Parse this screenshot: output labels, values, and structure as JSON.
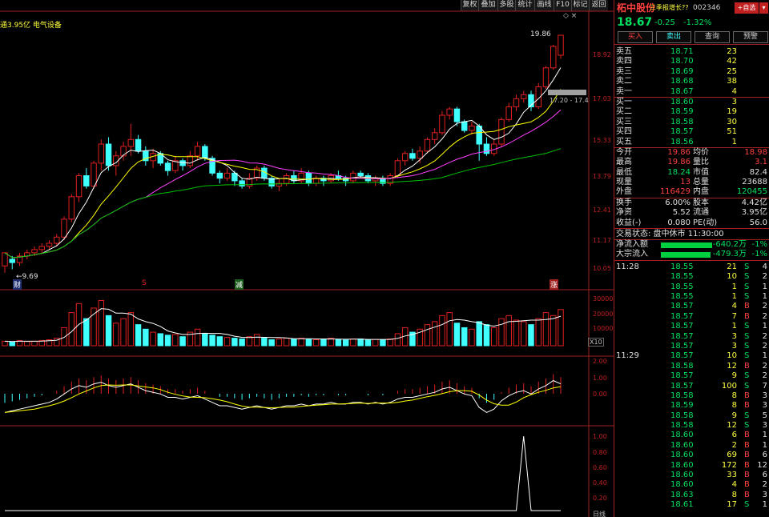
{
  "toolbar": {
    "buttons": [
      "复权",
      "叠加",
      "多股",
      "统计",
      "画线",
      "F10",
      "标记",
      "返回"
    ]
  },
  "chart": {
    "market_cap_label": "通3.95亿 电气设备",
    "price_axis": [
      "18.92",
      "17.03",
      "15.33",
      "13.79",
      "12.41",
      "11.17",
      "10.05"
    ],
    "high_label": "19.86",
    "low_label": "9.69",
    "price_range_label": "17.20 - 17.4",
    "markers": [
      "财",
      "S",
      "减",
      "涨"
    ],
    "volume_axis": [
      "30000",
      "20000",
      "10000"
    ],
    "volume_unit": "X10",
    "macd_axis": [
      "2.00",
      "1.00",
      "0.00"
    ],
    "ind3_axis": [
      "1.00",
      "0.80",
      "0.60",
      "0.40",
      "0.20"
    ],
    "bottom_label": "日线",
    "colors": {
      "up": "#e02020",
      "down": "#40ffff",
      "ma5": "#ffffff",
      "ma10": "#ffff00",
      "ma20": "#ff40ff",
      "ma60": "#00c000"
    }
  },
  "chart_data": {
    "type": "candlestick",
    "candles": [
      [
        9.9,
        10.3,
        9.7,
        10.1
      ],
      [
        10.1,
        10.0,
        9.8,
        10.2
      ],
      [
        10.0,
        10.2,
        9.9,
        10.3
      ],
      [
        10.2,
        10.3,
        10.1,
        10.4
      ],
      [
        10.3,
        10.4,
        10.2,
        10.5
      ],
      [
        10.4,
        10.5,
        10.3,
        10.6
      ],
      [
        10.5,
        10.6,
        10.4,
        10.7
      ],
      [
        10.6,
        10.8,
        10.5,
        10.9
      ],
      [
        10.8,
        11.4,
        10.7,
        11.5
      ],
      [
        11.4,
        12.2,
        11.3,
        12.3
      ],
      [
        12.2,
        13.0,
        12.0,
        13.1
      ],
      [
        13.0,
        12.6,
        12.5,
        13.3
      ],
      [
        12.6,
        13.5,
        12.5,
        13.6
      ],
      [
        13.5,
        14.3,
        13.2,
        14.5
      ],
      [
        14.3,
        13.4,
        13.2,
        14.6
      ],
      [
        13.4,
        13.8,
        13.0,
        14.0
      ],
      [
        13.8,
        14.2,
        13.6,
        14.4
      ],
      [
        14.2,
        14.5,
        13.8,
        15.2
      ],
      [
        14.5,
        14.0,
        13.9,
        14.7
      ],
      [
        14.0,
        13.6,
        13.4,
        14.2
      ],
      [
        13.6,
        13.9,
        13.3,
        14.1
      ],
      [
        13.9,
        13.5,
        13.4,
        14.0
      ],
      [
        13.5,
        13.2,
        13.0,
        13.6
      ],
      [
        13.2,
        13.6,
        13.1,
        13.8
      ],
      [
        13.6,
        13.4,
        13.2,
        13.7
      ],
      [
        13.4,
        13.8,
        13.3,
        14.0
      ],
      [
        13.8,
        14.2,
        13.6,
        14.4
      ],
      [
        14.2,
        13.7,
        13.6,
        14.3
      ],
      [
        13.7,
        13.1,
        13.0,
        13.8
      ],
      [
        13.1,
        12.9,
        12.7,
        13.2
      ],
      [
        12.9,
        13.1,
        12.8,
        13.3
      ],
      [
        13.1,
        12.8,
        12.6,
        13.2
      ],
      [
        12.8,
        12.6,
        12.5,
        12.9
      ],
      [
        12.6,
        12.9,
        12.5,
        13.1
      ],
      [
        12.9,
        13.3,
        12.8,
        13.4
      ],
      [
        13.3,
        12.9,
        12.8,
        13.4
      ],
      [
        12.9,
        12.6,
        12.5,
        13.0
      ],
      [
        12.6,
        12.7,
        12.4,
        12.9
      ],
      [
        12.7,
        13.0,
        12.6,
        13.1
      ],
      [
        13.0,
        12.8,
        12.7,
        13.2
      ],
      [
        12.8,
        13.1,
        12.7,
        13.3
      ],
      [
        13.1,
        12.7,
        12.6,
        13.2
      ],
      [
        12.7,
        12.9,
        12.6,
        13.0
      ],
      [
        12.9,
        12.8,
        12.6,
        13.0
      ],
      [
        12.8,
        13.0,
        12.7,
        13.1
      ],
      [
        13.0,
        12.9,
        12.8,
        13.2
      ],
      [
        12.9,
        12.8,
        12.6,
        13.0
      ],
      [
        12.8,
        13.1,
        12.7,
        13.2
      ],
      [
        13.1,
        13.0,
        12.9,
        13.2
      ],
      [
        13.0,
        12.8,
        12.7,
        13.1
      ],
      [
        12.8,
        12.9,
        12.6,
        13.0
      ],
      [
        12.9,
        12.7,
        12.6,
        13.0
      ],
      [
        12.7,
        13.0,
        12.6,
        13.1
      ],
      [
        13.0,
        13.6,
        12.9,
        13.7
      ],
      [
        13.6,
        13.9,
        13.4,
        14.0
      ],
      [
        13.9,
        13.7,
        13.6,
        14.1
      ],
      [
        13.7,
        14.0,
        13.5,
        14.2
      ],
      [
        14.0,
        14.5,
        13.9,
        14.6
      ],
      [
        14.5,
        14.8,
        14.3,
        15.0
      ],
      [
        14.8,
        15.6,
        14.7,
        15.8
      ],
      [
        15.6,
        15.9,
        15.4,
        16.0
      ],
      [
        15.9,
        15.3,
        15.1,
        16.0
      ],
      [
        15.3,
        14.9,
        14.8,
        15.4
      ],
      [
        14.9,
        15.1,
        14.7,
        15.3
      ],
      [
        15.1,
        14.3,
        13.6,
        15.2
      ],
      [
        14.3,
        13.9,
        13.8,
        14.6
      ],
      [
        13.9,
        14.3,
        13.8,
        14.5
      ],
      [
        14.3,
        15.4,
        14.2,
        15.5
      ],
      [
        15.4,
        16.0,
        15.3,
        16.2
      ],
      [
        16.0,
        16.4,
        15.8,
        16.6
      ],
      [
        16.4,
        16.6,
        16.2,
        16.8
      ],
      [
        16.6,
        16.0,
        15.8,
        16.8
      ],
      [
        16.0,
        17.0,
        15.9,
        17.2
      ],
      [
        17.0,
        18.0,
        16.9,
        18.1
      ],
      [
        18.0,
        19.2,
        17.9,
        19.3
      ],
      [
        18.7,
        19.86,
        18.5,
        19.86
      ]
    ],
    "ma_series": [
      "ma5",
      "ma10",
      "ma20",
      "ma60"
    ],
    "volume": [
      3000,
      2500,
      3500,
      2800,
      3000,
      3500,
      4000,
      5000,
      12000,
      22000,
      28000,
      18000,
      25000,
      30000,
      20000,
      15000,
      18000,
      22000,
      14000,
      11000,
      9000,
      8000,
      7000,
      7500,
      6000,
      9000,
      11000,
      8000,
      7000,
      6000,
      5500,
      5000,
      4500,
      6000,
      7500,
      5000,
      4000,
      4500,
      5000,
      4500,
      5000,
      4200,
      4000,
      4500,
      5000,
      4200,
      3800,
      4500,
      4500,
      4000,
      4200,
      3800,
      4500,
      8000,
      12000,
      9000,
      11000,
      14000,
      16000,
      20000,
      22000,
      15000,
      12000,
      11000,
      16000,
      14000,
      12000,
      18000,
      20000,
      17000,
      16000,
      14000,
      18000,
      22000,
      20000,
      24000
    ],
    "macd": [
      -0.6,
      -0.5,
      -0.4,
      -0.3,
      -0.2,
      -0.1,
      0.0,
      0.2,
      0.5,
      0.8,
      1.0,
      0.9,
      1.1,
      1.2,
      1.0,
      0.9,
      1.0,
      1.1,
      0.9,
      0.7,
      0.6,
      0.5,
      0.3,
      0.3,
      0.2,
      0.3,
      0.4,
      0.2,
      0.0,
      -0.2,
      -0.2,
      -0.3,
      -0.4,
      -0.3,
      -0.2,
      -0.3,
      -0.4,
      -0.3,
      -0.2,
      -0.2,
      -0.1,
      -0.2,
      -0.1,
      -0.1,
      0.0,
      -0.1,
      -0.1,
      0.0,
      0.0,
      -0.1,
      0.0,
      -0.1,
      0.0,
      0.2,
      0.3,
      0.3,
      0.4,
      0.5,
      0.6,
      0.8,
      0.9,
      0.7,
      0.5,
      0.4,
      -0.3,
      -0.6,
      -0.4,
      0.1,
      0.4,
      0.6,
      0.7,
      0.5,
      0.8,
      1.0,
      1.3,
      1.1
    ],
    "ind3": [
      0,
      0,
      0,
      0,
      0,
      0,
      0,
      0,
      0,
      0,
      0,
      0,
      0,
      0,
      0,
      0,
      0,
      0,
      0,
      0,
      0,
      0,
      0,
      0,
      0,
      0,
      0,
      0,
      0,
      0,
      0,
      0,
      0,
      0,
      0,
      0,
      0,
      0,
      0,
      0,
      0,
      0,
      0,
      0,
      0,
      0,
      0,
      0,
      0,
      0,
      0,
      0,
      0,
      0,
      0,
      0,
      0,
      0,
      0,
      0,
      0,
      0,
      0,
      0,
      0,
      0,
      0,
      0,
      0,
      0,
      1,
      0,
      0,
      0,
      0,
      0
    ]
  },
  "panel": {
    "name": "柘中股份",
    "tip": "三季报增长??",
    "code": "002346",
    "add_label": "+自选",
    "add_arrow": "▾",
    "price": "18.67",
    "change": "-0.25",
    "change_pct": "-1.32%",
    "buttons": [
      "买入",
      "卖出",
      "查询",
      "预警"
    ],
    "asks": [
      {
        "label": "卖五",
        "price": "18.71",
        "vol": "23"
      },
      {
        "label": "卖四",
        "price": "18.70",
        "vol": "42"
      },
      {
        "label": "卖三",
        "price": "18.69",
        "vol": "25"
      },
      {
        "label": "卖二",
        "price": "18.68",
        "vol": "38"
      },
      {
        "label": "卖一",
        "price": "18.67",
        "vol": "4"
      }
    ],
    "bids": [
      {
        "label": "买一",
        "price": "18.60",
        "vol": "3"
      },
      {
        "label": "买二",
        "price": "18.59",
        "vol": "19"
      },
      {
        "label": "买三",
        "price": "18.58",
        "vol": "30"
      },
      {
        "label": "买四",
        "price": "18.57",
        "vol": "51"
      },
      {
        "label": "买五",
        "price": "18.56",
        "vol": "1"
      }
    ],
    "stats": [
      {
        "l1": "今开",
        "v1": "19.86",
        "l2": "均价",
        "v2": "18.98"
      },
      {
        "l1": "最高",
        "v1": "19.86",
        "l2": "量比",
        "v2": "3.1"
      },
      {
        "l1": "最低",
        "v1": "18.24",
        "l2": "市值",
        "v2": "82.4"
      },
      {
        "l1": "现量",
        "v1": "13",
        "l2": "总量",
        "v2": "23688"
      },
      {
        "l1": "外盘",
        "v1": "116429",
        "l2": "内盘",
        "v2": "120455"
      }
    ],
    "stats2": [
      {
        "l1": "换手",
        "v1": "6.00%",
        "l2": "股本",
        "v2": "4.42亿"
      },
      {
        "l1": "净资",
        "v1": "5.52",
        "l2": "流通",
        "v2": "3.95亿"
      },
      {
        "l1": "收益(-)",
        "v1": "0.080",
        "l2": "PE(动)",
        "v2": "56.0"
      }
    ],
    "status_label": "交易状态: 盘中休市 11:30:00",
    "flows": [
      {
        "label": "净流入额",
        "value": "-640.2万",
        "pct": "-1%"
      },
      {
        "label": "大宗流入",
        "value": "-479.3万",
        "pct": "-1%"
      }
    ],
    "ticks": [
      {
        "t": "11:28",
        "p": "18.55",
        "v": "21",
        "s": "S",
        "n": "4"
      },
      {
        "t": "",
        "p": "18.55",
        "v": "10",
        "s": "S",
        "n": "2"
      },
      {
        "t": "",
        "p": "18.55",
        "v": "1",
        "s": "S",
        "n": "1"
      },
      {
        "t": "",
        "p": "18.55",
        "v": "1",
        "s": "S",
        "n": "1"
      },
      {
        "t": "",
        "p": "18.57",
        "v": "4",
        "s": "B",
        "n": "2"
      },
      {
        "t": "",
        "p": "18.57",
        "v": "7",
        "s": "B",
        "n": "2"
      },
      {
        "t": "",
        "p": "18.57",
        "v": "1",
        "s": "S",
        "n": "1"
      },
      {
        "t": "",
        "p": "18.57",
        "v": "3",
        "s": "S",
        "n": "2"
      },
      {
        "t": "",
        "p": "18.57",
        "v": "3",
        "s": "S",
        "n": "2"
      },
      {
        "t": "11:29",
        "p": "18.57",
        "v": "10",
        "s": "S",
        "n": "1"
      },
      {
        "t": "",
        "p": "18.58",
        "v": "12",
        "s": "B",
        "n": "2"
      },
      {
        "t": "",
        "p": "18.57",
        "v": "9",
        "s": "S",
        "n": "2"
      },
      {
        "t": "",
        "p": "18.57",
        "v": "100",
        "s": "S",
        "n": "7"
      },
      {
        "t": "",
        "p": "18.58",
        "v": "8",
        "s": "B",
        "n": "3"
      },
      {
        "t": "",
        "p": "18.59",
        "v": "8",
        "s": "B",
        "n": "3"
      },
      {
        "t": "",
        "p": "18.58",
        "v": "9",
        "s": "S",
        "n": "5"
      },
      {
        "t": "",
        "p": "18.58",
        "v": "12",
        "s": "S",
        "n": "3"
      },
      {
        "t": "",
        "p": "18.60",
        "v": "6",
        "s": "B",
        "n": "1"
      },
      {
        "t": "",
        "p": "18.60",
        "v": "2",
        "s": "B",
        "n": "1"
      },
      {
        "t": "",
        "p": "18.60",
        "v": "69",
        "s": "B",
        "n": "6"
      },
      {
        "t": "",
        "p": "18.60",
        "v": "172",
        "s": "B",
        "n": "12"
      },
      {
        "t": "",
        "p": "18.60",
        "v": "33",
        "s": "B",
        "n": "6"
      },
      {
        "t": "",
        "p": "18.60",
        "v": "4",
        "s": "B",
        "n": "2"
      },
      {
        "t": "",
        "p": "18.63",
        "v": "8",
        "s": "B",
        "n": "3"
      },
      {
        "t": "",
        "p": "18.61",
        "v": "17",
        "s": "S",
        "n": "1"
      }
    ]
  }
}
